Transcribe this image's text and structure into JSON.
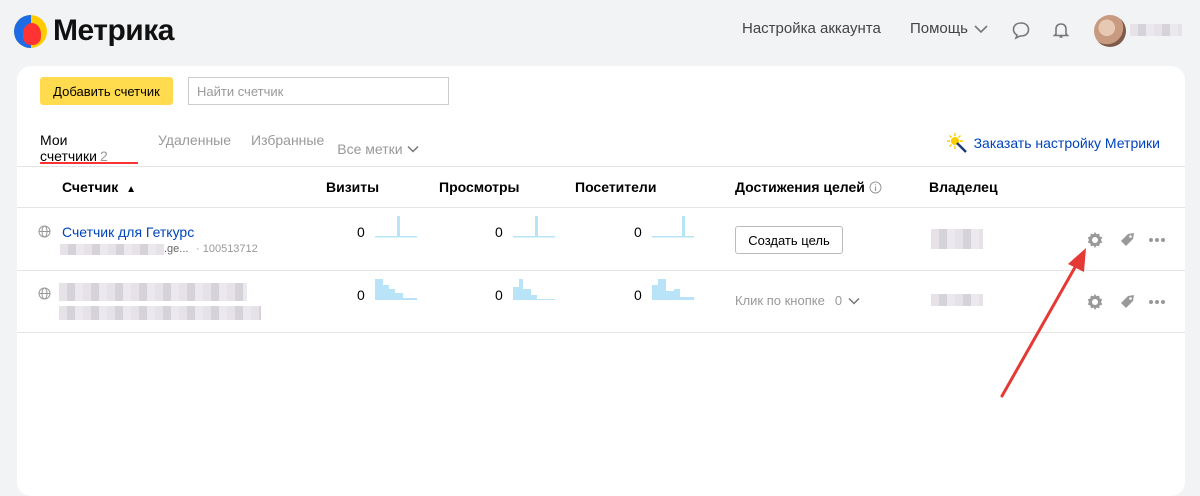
{
  "header": {
    "brand": "Метрика",
    "account_settings": "Настройка аккаунта",
    "help": "Помощь"
  },
  "toolbar": {
    "add_counter": "Добавить счетчик",
    "search_placeholder": "Найти счетчик"
  },
  "tabs": {
    "mine": "Мои счетчики",
    "mine_count": "2",
    "deleted": "Удаленные",
    "favorites": "Избранные",
    "all_tags": "Все метки"
  },
  "order_setup": "Заказать настройку Метрики",
  "columns": {
    "counter": "Счетчик",
    "sort_arrow": "▲",
    "visits": "Визиты",
    "views": "Просмотры",
    "visitors": "Посетители",
    "goals": "Достижения целей",
    "owner": "Владелец"
  },
  "rows": [
    {
      "name": "Счетчик для Геткурс",
      "domain_suffix": ".ge...",
      "id": "· 100513712",
      "visits": "0",
      "views": "0",
      "visitors": "0",
      "goal_button": "Создать цель"
    },
    {
      "visits": "0",
      "views": "0",
      "visitors": "0",
      "goal_name": "Клик по кнопке",
      "goal_value": "0"
    }
  ],
  "colors": {
    "accent": "#ffdb4d",
    "link": "#0044bb",
    "active_tab": "#ff3333",
    "arrow": "#e53935",
    "spark": "#b9e4f7"
  }
}
